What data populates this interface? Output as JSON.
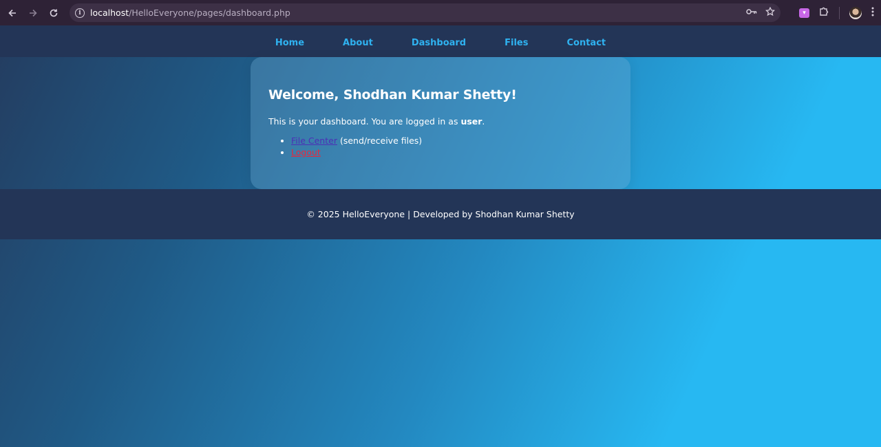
{
  "browser": {
    "url_host": "localhost",
    "url_path": "/HelloEveryone/pages/dashboard.php",
    "icons": [
      "back-arrow-icon",
      "forward-arrow-icon",
      "reload-icon",
      "site-info-icon",
      "password-key-icon",
      "bookmark-star-icon",
      "extension-icon",
      "puzzle-icon",
      "profile-avatar",
      "kebab-menu-icon"
    ]
  },
  "nav": {
    "items": [
      {
        "label": "Home"
      },
      {
        "label": "About"
      },
      {
        "label": "Dashboard"
      },
      {
        "label": "Files"
      },
      {
        "label": "Contact"
      }
    ]
  },
  "dashboard": {
    "heading": "Welcome, Shodhan Kumar Shetty!",
    "intro_prefix": "This is your dashboard. You are logged in as ",
    "role": "user",
    "intro_suffix": ".",
    "file_center_link": "File Center",
    "file_center_desc": " (send/receive files)",
    "logout_link": "Logout"
  },
  "footer": {
    "text": "© 2025 HelloEveryone | Developed by Shodhan Kumar Shetty"
  },
  "colors": {
    "nav_bg": "#233557",
    "nav_link": "#2fb2f0",
    "file_link": "#4c2fb6",
    "logout_link": "#e7283c"
  }
}
